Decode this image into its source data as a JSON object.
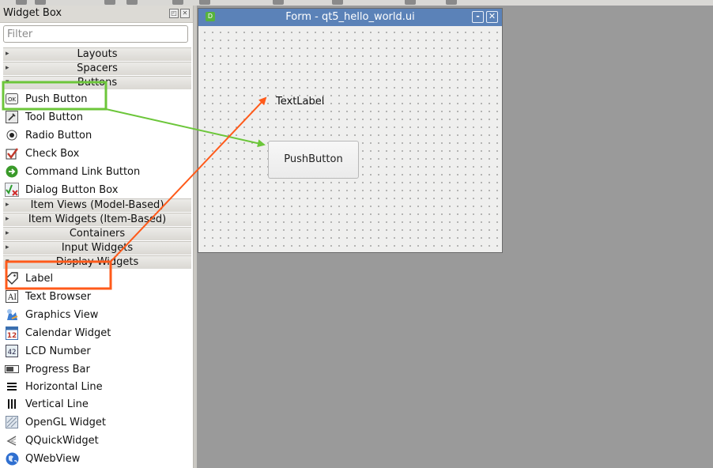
{
  "widget_box": {
    "title": "Widget Box",
    "filter_placeholder": "Filter",
    "categories": {
      "layouts": "Layouts",
      "spacers": "Spacers",
      "buttons": "Buttons",
      "item_views": "Item Views (Model-Based)",
      "item_widgets": "Item Widgets (Item-Based)",
      "containers": "Containers",
      "input_widgets": "Input Widgets",
      "display_widgets": "Display Widgets"
    },
    "buttons_items": [
      "Push Button",
      "Tool Button",
      "Radio Button",
      "Check Box",
      "Command Link Button",
      "Dialog Button Box"
    ],
    "display_items": [
      "Label",
      "Text Browser",
      "Graphics View",
      "Calendar Widget",
      "LCD Number",
      "Progress Bar",
      "Horizontal Line",
      "Vertical Line",
      "OpenGL Widget",
      "QQuickWidget",
      "QWebView"
    ]
  },
  "form_window": {
    "title": "Form - qt5_hello_world.ui",
    "text_label": "TextLabel",
    "push_button": "PushButton"
  },
  "annotations": {
    "green_color": "#6cc63a",
    "orange_color": "#ff5a1a"
  }
}
